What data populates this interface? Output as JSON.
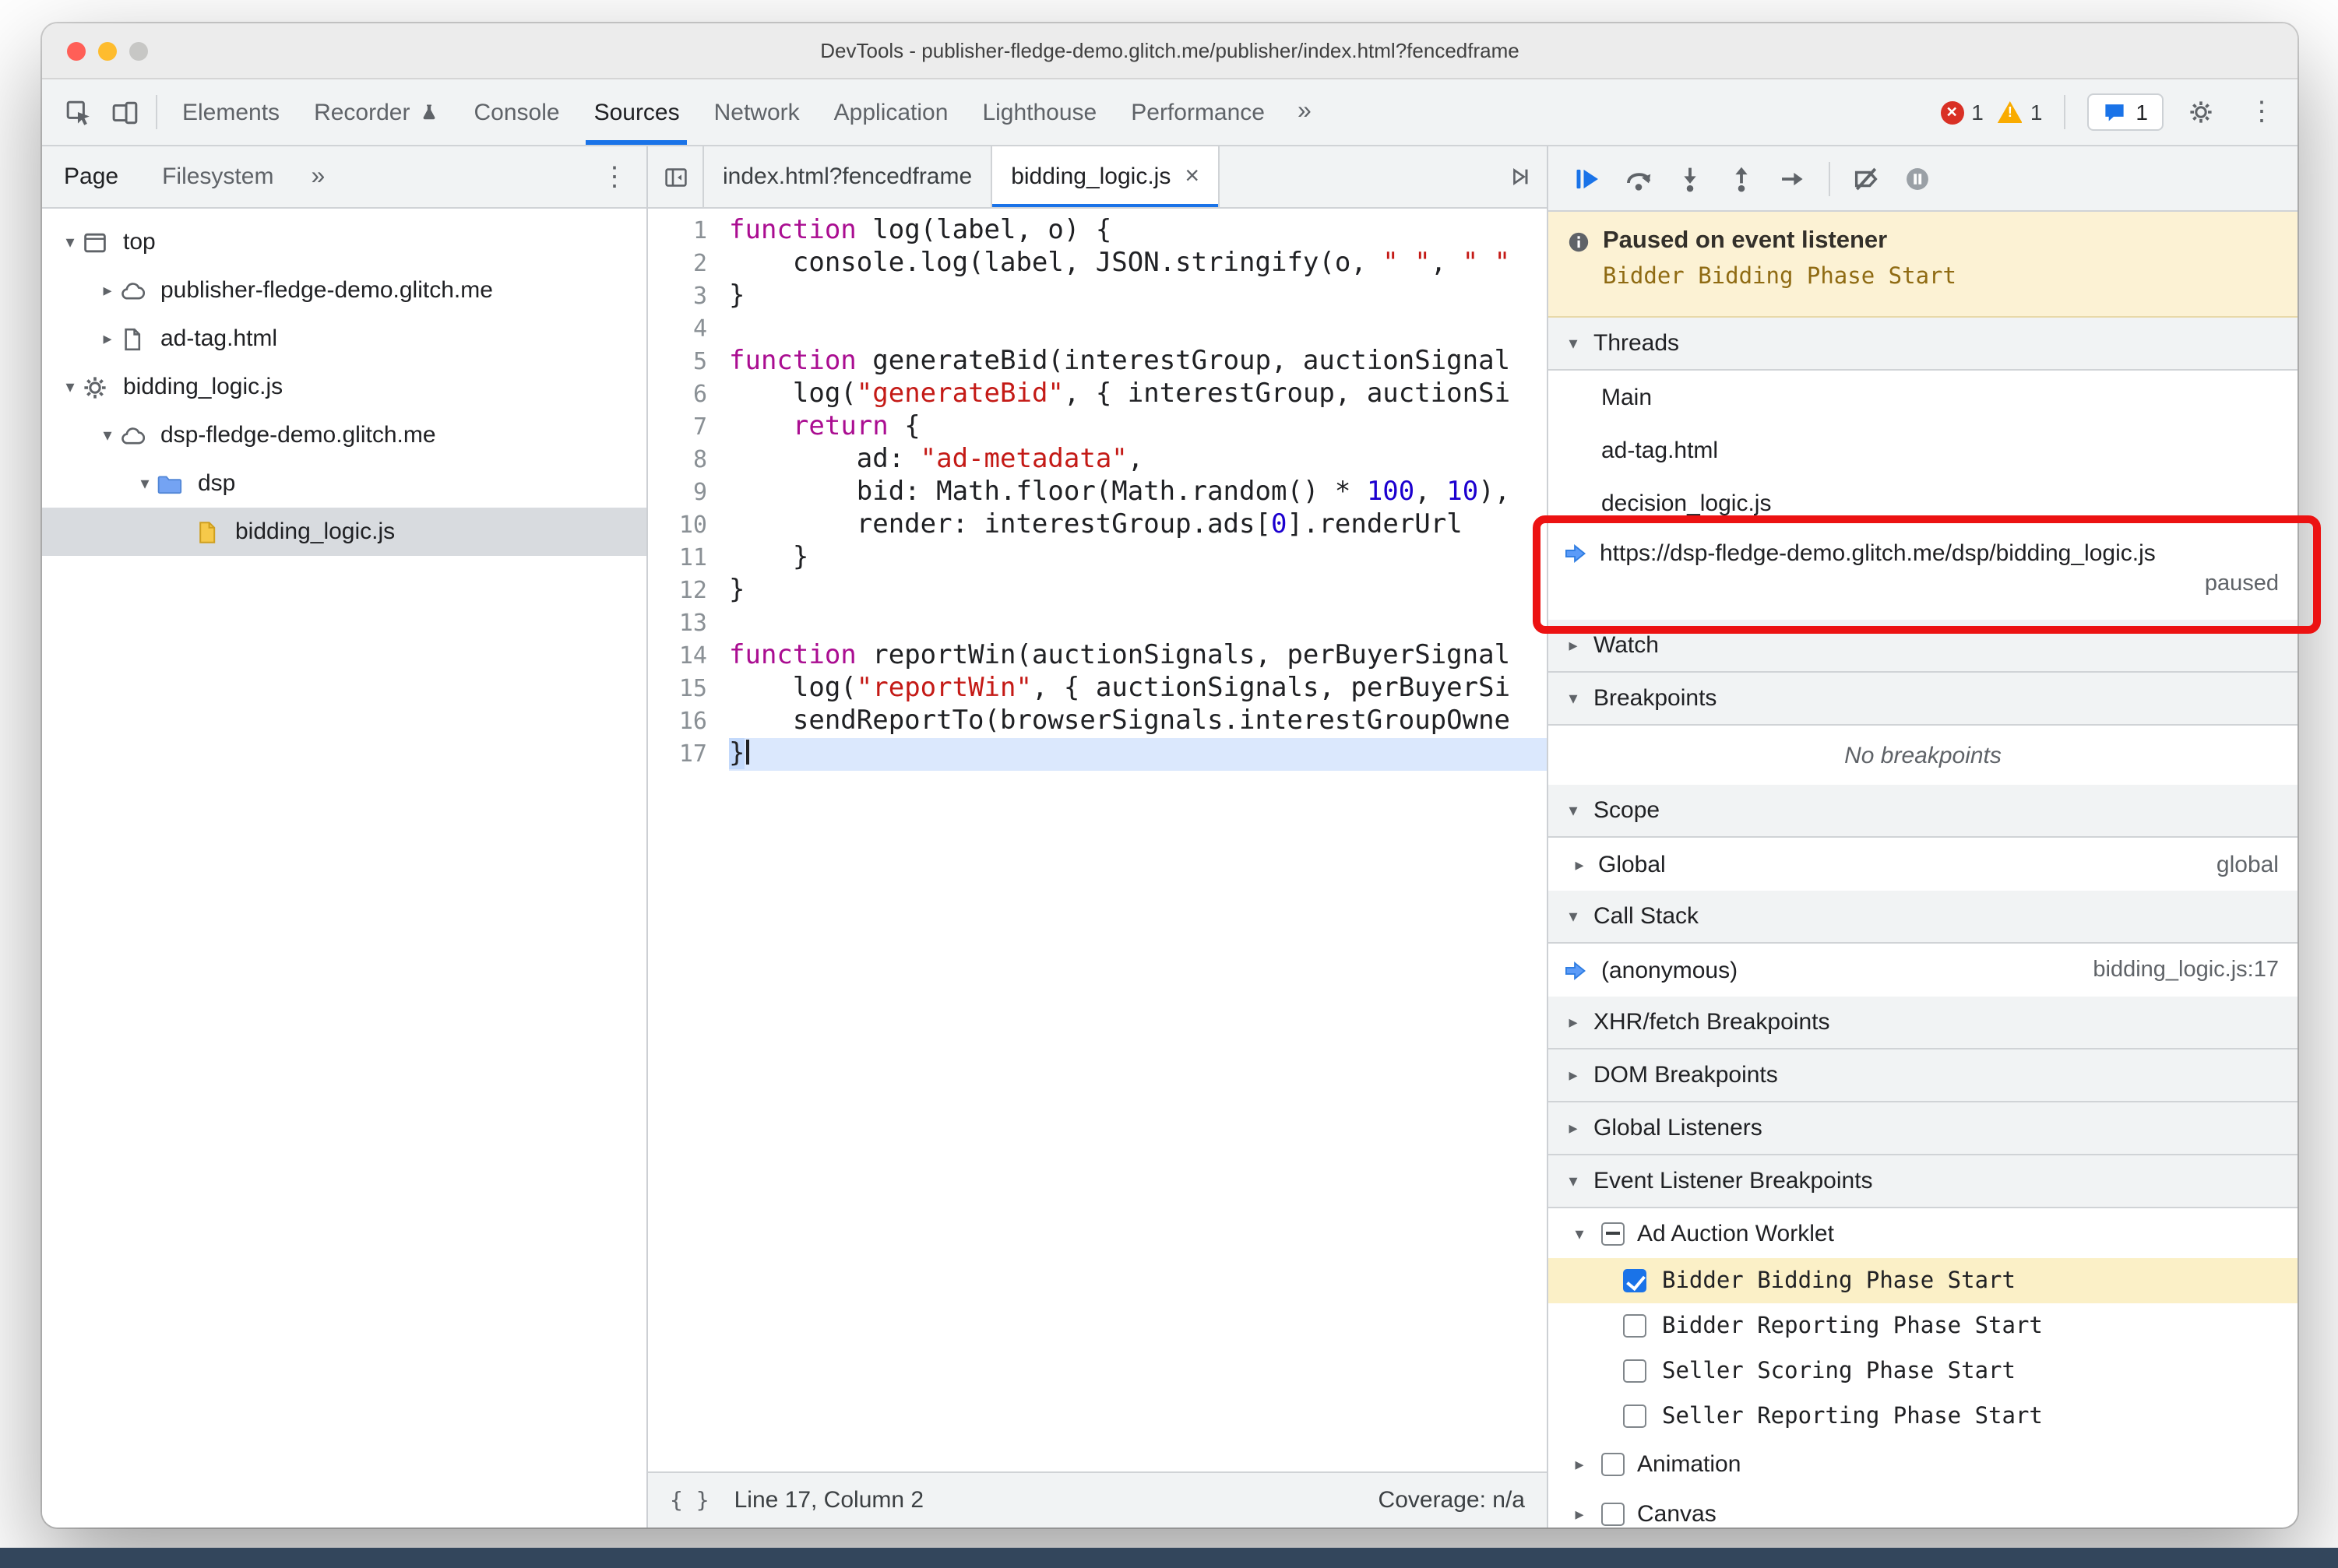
{
  "window": {
    "title": "DevTools - publisher-fledge-demo.glitch.me/publisher/index.html?fencedframe"
  },
  "colors": {
    "accent_blue": "#1a73e8",
    "annotation_red": "#ec1212",
    "paused_banner_bg": "#fcf2d4",
    "breakpoint_highlight": "#fbf0c7",
    "keyword": "#aa0d91",
    "string": "#c41a16",
    "number": "#1c00cf"
  },
  "toolbar": {
    "left_icons": [
      "inspect-element",
      "device-toolbar"
    ],
    "tabs": [
      "Elements",
      "Recorder",
      "Console",
      "Sources",
      "Network",
      "Application",
      "Lighthouse",
      "Performance"
    ],
    "active_tab": "Sources",
    "more_symbol": "»",
    "kebab_symbol": "⋮",
    "error_count": "1",
    "warning_count": "1",
    "issues_count": "1"
  },
  "sidebar": {
    "tabs": [
      "Page",
      "Filesystem"
    ],
    "active_tab": "Page",
    "more_symbol": "»",
    "kebab_symbol": "⋮",
    "tree": [
      {
        "label": "top",
        "icon": "frame",
        "expand": "open",
        "depth": 0
      },
      {
        "label": "publisher-fledge-demo.glitch.me",
        "icon": "cloud",
        "expand": "closed",
        "depth": 1
      },
      {
        "label": "ad-tag.html",
        "icon": "doc",
        "expand": "closed",
        "depth": 1
      },
      {
        "label": "bidding_logic.js",
        "icon": "gear",
        "expand": "open",
        "depth": 0
      },
      {
        "label": "dsp-fledge-demo.glitch.me",
        "icon": "cloud",
        "expand": "open",
        "depth": 1
      },
      {
        "label": "dsp",
        "icon": "folder",
        "expand": "open",
        "depth": 2
      },
      {
        "label": "bidding_logic.js",
        "icon": "jsfile",
        "expand": "none",
        "depth": 3,
        "selected": true
      }
    ]
  },
  "editor": {
    "tabs": [
      {
        "label": "index.html?fencedframe",
        "active": false,
        "closable": false
      },
      {
        "label": "bidding_logic.js",
        "active": true,
        "closable": true,
        "close_symbol": "×"
      }
    ],
    "status": {
      "pretty_print": "{ }",
      "line_col": "Line 17, Column 2",
      "coverage": "Coverage: n/a"
    },
    "code_lines": [
      {
        "n": "1",
        "segs": [
          [
            "kw",
            "function"
          ],
          [
            "pl",
            " log(label, o) {"
          ]
        ]
      },
      {
        "n": "2",
        "segs": [
          [
            "pl",
            "    console.log(label, JSON.stringify(o, "
          ],
          [
            "str",
            "\" \""
          ],
          [
            "pl",
            ", "
          ],
          [
            "str",
            "\" \""
          ]
        ]
      },
      {
        "n": "3",
        "segs": [
          [
            "pl",
            "}"
          ]
        ]
      },
      {
        "n": "4",
        "segs": []
      },
      {
        "n": "5",
        "segs": [
          [
            "kw",
            "function"
          ],
          [
            "pl",
            " generateBid(interestGroup, auctionSignal"
          ]
        ]
      },
      {
        "n": "6",
        "segs": [
          [
            "pl",
            "    log("
          ],
          [
            "str",
            "\"generateBid\""
          ],
          [
            "pl",
            ", { interestGroup, auctionSi"
          ]
        ]
      },
      {
        "n": "7",
        "segs": [
          [
            "pl",
            "    "
          ],
          [
            "kw",
            "return"
          ],
          [
            "pl",
            " {"
          ]
        ]
      },
      {
        "n": "8",
        "segs": [
          [
            "pl",
            "        ad: "
          ],
          [
            "str",
            "\"ad-metadata\""
          ],
          [
            "pl",
            ","
          ]
        ]
      },
      {
        "n": "9",
        "segs": [
          [
            "pl",
            "        bid: Math.floor(Math.random() * "
          ],
          [
            "num",
            "100"
          ],
          [
            "pl",
            ", "
          ],
          [
            "num",
            "10"
          ],
          [
            "pl",
            "),"
          ]
        ]
      },
      {
        "n": "10",
        "segs": [
          [
            "pl",
            "        render: interestGroup.ads["
          ],
          [
            "num",
            "0"
          ],
          [
            "pl",
            "].renderUrl"
          ]
        ]
      },
      {
        "n": "11",
        "segs": [
          [
            "pl",
            "    }"
          ]
        ]
      },
      {
        "n": "12",
        "segs": [
          [
            "pl",
            "}"
          ]
        ]
      },
      {
        "n": "13",
        "segs": []
      },
      {
        "n": "14",
        "segs": [
          [
            "kw",
            "function"
          ],
          [
            "pl",
            " reportWin(auctionSignals, perBuyerSignal"
          ]
        ]
      },
      {
        "n": "15",
        "segs": [
          [
            "pl",
            "    log("
          ],
          [
            "str",
            "\"reportWin\""
          ],
          [
            "pl",
            ", { auctionSignals, perBuyerSi"
          ]
        ]
      },
      {
        "n": "16",
        "segs": [
          [
            "pl",
            "    sendReportTo(browserSignals.interestGroupOwne"
          ]
        ]
      },
      {
        "n": "17",
        "cur": true,
        "segs": [
          [
            "pl",
            "}"
          ]
        ]
      }
    ]
  },
  "debugger": {
    "toolbar_icons": [
      "resume",
      "step-over",
      "step-into",
      "step-out",
      "step",
      "separator",
      "deactivate-breakpoints",
      "pause-on-exceptions"
    ],
    "paused": {
      "title": "Paused on event listener",
      "subtitle": "Bidder Bidding Phase Start"
    },
    "threads": {
      "title": "Threads",
      "items": [
        {
          "label": "Main"
        },
        {
          "label": "ad-tag.html"
        },
        {
          "label": "decision_logic.js"
        },
        {
          "label": "https://dsp-fledge-demo.glitch.me/dsp/bidding_logic.js",
          "status": "paused",
          "current": true
        }
      ]
    },
    "watch": {
      "title": "Watch"
    },
    "breakpoints": {
      "title": "Breakpoints",
      "empty": "No breakpoints"
    },
    "scope": {
      "title": "Scope",
      "items": [
        {
          "label": "Global",
          "value": "global"
        }
      ]
    },
    "call_stack": {
      "title": "Call Stack",
      "items": [
        {
          "label": "(anonymous)",
          "location": "bidding_logic.js:17"
        }
      ]
    },
    "xhr": {
      "title": "XHR/fetch Breakpoints"
    },
    "dom": {
      "title": "DOM Breakpoints"
    },
    "global_listeners": {
      "title": "Global Listeners"
    },
    "elb": {
      "title": "Event Listener Breakpoints",
      "groups": [
        {
          "label": "Ad Auction Worklet",
          "state": "indeterminate",
          "expanded": true,
          "children": [
            {
              "label": "Bidder Bidding Phase Start",
              "checked": true,
              "highlighted": true
            },
            {
              "label": "Bidder Reporting Phase Start",
              "checked": false
            },
            {
              "label": "Seller Scoring Phase Start",
              "checked": false
            },
            {
              "label": "Seller Reporting Phase Start",
              "checked": false
            }
          ]
        },
        {
          "label": "Animation",
          "state": "unchecked",
          "expanded": false,
          "children": []
        },
        {
          "label": "Canvas",
          "state": "unchecked",
          "expanded": false,
          "children": []
        }
      ]
    }
  }
}
